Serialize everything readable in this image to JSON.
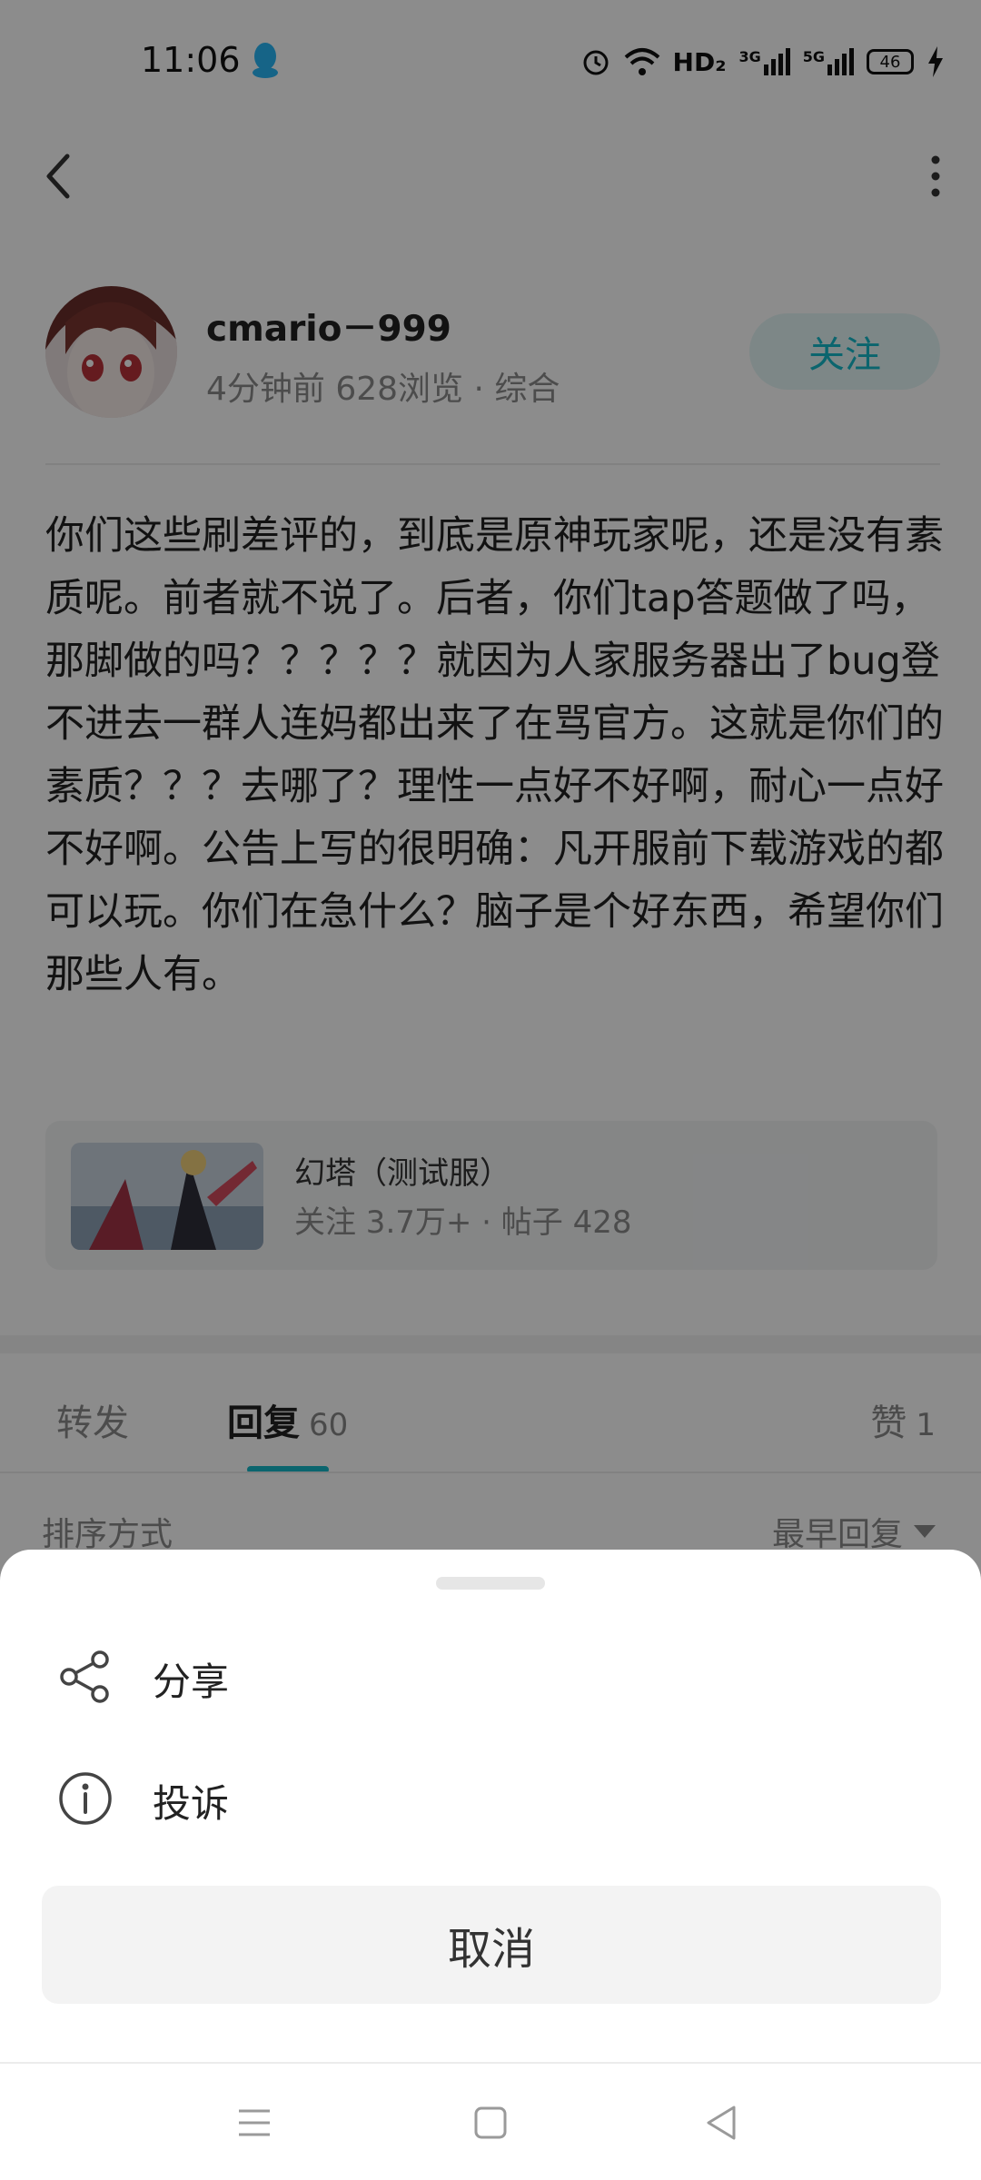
{
  "status_bar": {
    "time": "11:06",
    "network_label": "HD₂",
    "signal_1": "3G",
    "signal_2": "5G",
    "battery": "46"
  },
  "post": {
    "author_name": "cmario－999",
    "meta": "4分钟前  628浏览 · 综合",
    "follow_label": "关注",
    "body": "你们这些刷差评的，到底是原神玩家呢，还是没有素质呢。前者就不说了。后者，你们tap答题做了吗，那脚做的吗？？？？？就因为人家服务器出了bug登不进去一群人连妈都出来了在骂官方。这就是你们的素质？？？去哪了？理性一点好不好啊，耐心一点好不好啊。公告上写的很明确：凡开服前下载游戏的都可以玩。你们在急什么？脑子是个好东西，希望你们那些人有。"
  },
  "forum": {
    "name": "幻塔（测试服）",
    "stats": "关注 3.7万+ · 帖子 428"
  },
  "tabs": [
    {
      "label": "转发",
      "count": ""
    },
    {
      "label": "回复",
      "count": "60"
    },
    {
      "label": "赞",
      "count": "1"
    }
  ],
  "sort": {
    "label": "排序方式",
    "value": "最早回复"
  },
  "sheet": {
    "items": [
      {
        "label": "分享",
        "icon": "share-icon"
      },
      {
        "label": "投诉",
        "icon": "info-icon"
      }
    ],
    "cancel_label": "取消"
  },
  "colors": {
    "accent": "#14b9c8",
    "overlay": "rgba(0,0,0,0.45)"
  }
}
